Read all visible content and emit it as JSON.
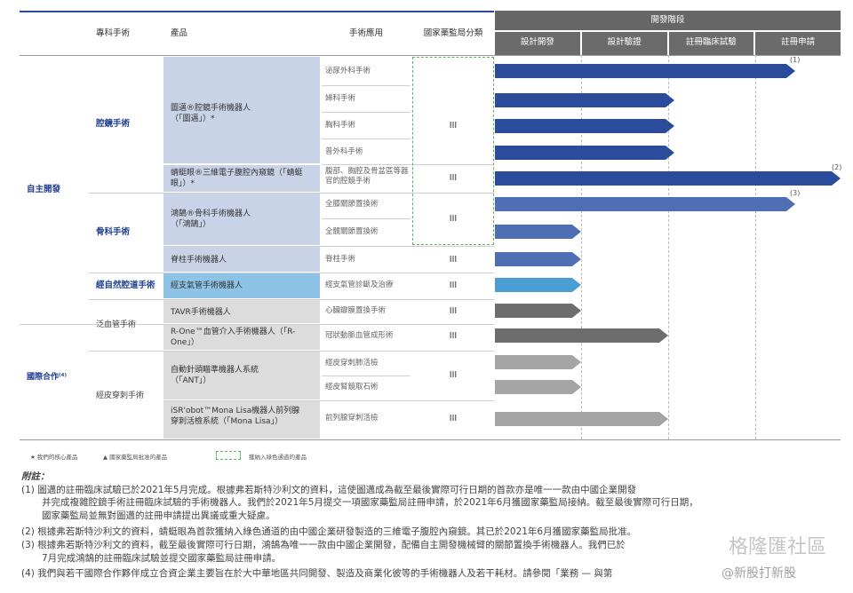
{
  "header": {
    "col_group": "專科手術",
    "col_product": "產品",
    "col_application": "手術應用",
    "col_class": "國家藥監局分類",
    "phase_title": "開發階段",
    "phases": [
      "設計開發",
      "設計驗證",
      "註冊臨床試驗",
      "註冊申請"
    ]
  },
  "sections": {
    "self": "自主開發",
    "intl": "國際合作⁽⁴⁾"
  },
  "groups": {
    "endo": "腔鏡手術",
    "ortho": "骨科手術",
    "natural": "經自然腔道手術",
    "vascular": "泛血管手術",
    "percut": "經皮穿刺手術"
  },
  "products": {
    "p1": "圖邁®腔鏡手術機器人（「圖邁」）*",
    "p2": "蜻蜓眼®三維電子腹腔內窺鏡（「蜻蜓眼」）*",
    "p3": "鴻鵠®骨科手術機器人（「鴻鵠」）",
    "p4": "脊柱手術機器人",
    "p5": "經支氣管手術機器人",
    "p6": "TAVR手術機器人",
    "p7": "R-One™血管介入手術機器人（「R-One」）",
    "p8": "自動針頭瞄準機器人系統（「ANT」）",
    "p9": "iSR'obot™Mona Lisa機器人前列腺穿刺活檢系統（「Mona Lisa」）"
  },
  "applications": [
    "泌尿外科手術",
    "婦科手術",
    "胸科手術",
    "普外科手術",
    "腹部、胸腔及骨盆區等器官的腔鏡手術",
    "全膝關節置換術",
    "全髖關節置換術",
    "脊柱手術",
    "經支氣管診斷及治療",
    "心臟瓣膜置換手術",
    "冠狀動脈血管成形術",
    "經皮穿刺肺活檢",
    "經皮腎鏡取石術",
    "前列腺穿刺活檢"
  ],
  "class_label": "III",
  "bar_colors": {
    "dark_blue": "#2b4c9b",
    "mid_blue": "#4f6fb5",
    "light_blue": "#4a9ed3",
    "dark_gray": "#6d6d6d",
    "light_gray": "#a5a5a5",
    "green_dash": "#5fb35f",
    "cell_blue": "#c9d3e8",
    "cell_lightblue": "#8dc3e6",
    "cell_gray": "#dcdcdc",
    "header_gray": "#6b6b6b"
  },
  "progress_bars": [
    {
      "row": "泌尿外科手術",
      "level": 0.87,
      "note": "(1)",
      "color": "dark_blue"
    },
    {
      "row": "婦科手術",
      "level": 0.52,
      "color": "dark_blue"
    },
    {
      "row": "胸科手術",
      "level": 0.52,
      "color": "dark_blue"
    },
    {
      "row": "普外科手術",
      "level": 0.52,
      "color": "dark_blue"
    },
    {
      "row": "腹部、胸腔及骨盆區等器官的腔鏡手術",
      "level": 1.0,
      "note": "(2)",
      "color": "dark_blue"
    },
    {
      "row": "全膝關節置換術",
      "level": 0.87,
      "note": "(3)",
      "color": "mid_blue"
    },
    {
      "row": "全髖關節置換術",
      "level": 0.25,
      "color": "mid_blue"
    },
    {
      "row": "脊柱手術",
      "level": 0.25,
      "color": "mid_blue"
    },
    {
      "row": "經支氣管診斷及治療",
      "level": 0.25,
      "color": "light_blue"
    },
    {
      "row": "心臟瓣膜置換手術",
      "level": 0.25,
      "color": "dark_gray"
    },
    {
      "row": "冠狀動脈血管成形術",
      "level": 0.5,
      "color": "dark_gray"
    },
    {
      "row": "經皮穿刺肺活檢",
      "level": 0.25,
      "color": "light_gray"
    },
    {
      "row": "經皮腎鏡取石術",
      "level": 0.25,
      "color": "light_gray"
    },
    {
      "row": "前列腺穿刺活檢",
      "level": 0.5,
      "color": "light_gray"
    }
  ],
  "legend": {
    "core": "我們的核心產品",
    "approved": "國家藥監局批准的產品",
    "green": "獲納入綠色通道的產品"
  },
  "notes": {
    "title": "附註：",
    "n1a": "(1)  圖邁的註冊臨床試驗已於2021年5月完成。根據弗若斯特沙利文的資料，這使圖邁成為截至最後實際可行日期的首款亦是唯一一款由中國企業開發",
    "n1b": "并完成複雜腔鏡手術註冊臨床試驗的手術機器人。我們於2021年5月提交一項國家藥監局註冊申請，於2021年6月獲國家藥監局接納。截至最後實際可行日期，",
    "n1c": "國家藥監局並無對圖邁的註冊申請提出異議或重大疑慮。",
    "n2": "(2)  根據弗若斯特沙利文的資料，蜻蜓眼為首款獲納入綠色通道的由中國企業研發製造的三維電子腹腔內窺鏡。其已於2021年6月獲國家藥監局批准。",
    "n3a": "(3)  根據弗若斯特沙利文的資料，截至最後實際可行日期，鴻鵠為唯一一款由中國企業開發，配備自主開發機械臂的關節置換手術機器人。我們已於",
    "n3b": "7月完成鴻鵠的註冊臨床試驗並提交國家藥監局註冊申請。",
    "n4": "(4)  我們與若干國際合作夥伴成立合資企業主要旨在於大中華地區共同開發、製造及商業化彼等的手術機器人及若干耗材。請參閱「業務 — 與第"
  },
  "watermark": {
    "a": "格隆匯社區",
    "b": "@新股打新股"
  }
}
